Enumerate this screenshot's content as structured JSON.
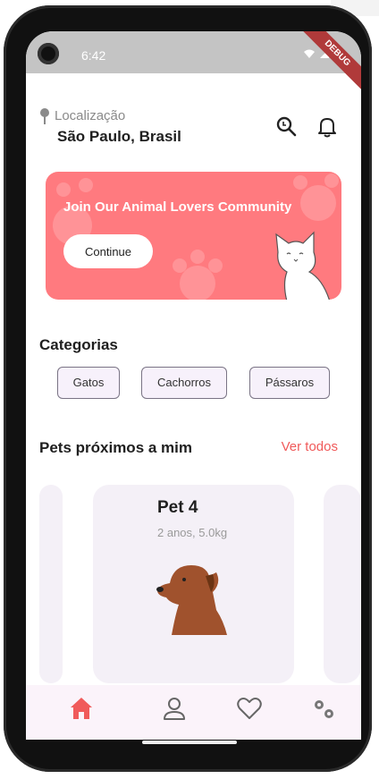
{
  "status_bar": {
    "time": "6:42",
    "debug": "DEBUG"
  },
  "location": {
    "label": "Localização",
    "value": "São Paulo, Brasil"
  },
  "banner": {
    "title": "Join Our Animal Lovers Community",
    "button": "Continue",
    "color": "#ff7a7f"
  },
  "categories": {
    "title": "Categorias",
    "items": [
      "Gatos",
      "Cachorros",
      "Pássaros"
    ]
  },
  "nearby": {
    "title": "Pets próximos a mim",
    "see_all": "Ver todos"
  },
  "pet_card": {
    "name": "Pet 4",
    "info": "2 anos, 5.0kg"
  },
  "bottom_nav": {
    "items": [
      "home-icon",
      "profile-icon",
      "heart-icon",
      "settings-icon"
    ],
    "active_color": "#f05a5a"
  }
}
